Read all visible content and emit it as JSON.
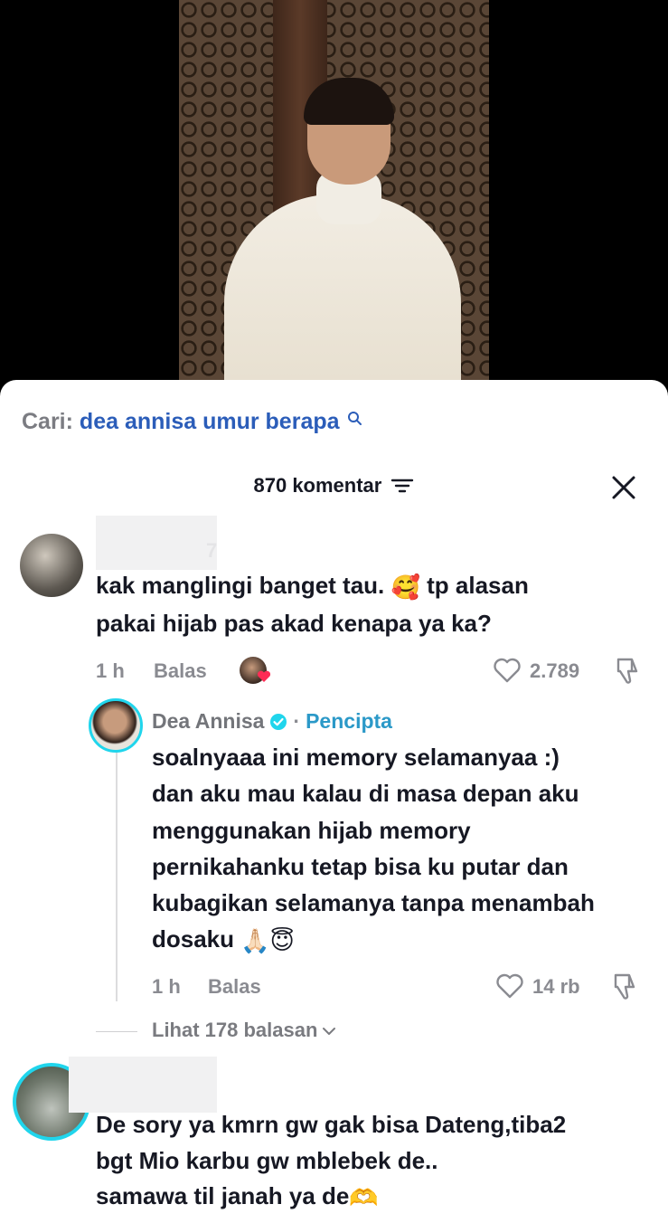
{
  "search": {
    "prefix": "Cari:",
    "query": "dea annisa umur berapa"
  },
  "header": {
    "count_label": "870 komentar"
  },
  "comments": [
    {
      "username_partial": "7",
      "text_line1": "kak manglingi banget tau.",
      "text_line1_emoji": "🥰",
      "text_line1_tail": "tp alasan",
      "text_line2": "pakai hijab pas akad kenapa ya ka?",
      "time": "1 h",
      "reply_label": "Balas",
      "likes": "2.789"
    },
    {
      "username_partial": "",
      "text_line1": "De sory ya kmrn gw gak bisa Dateng,tiba2",
      "text_line2": "bgt Mio karbu gw mblebek de..",
      "text_line3": "samawa til janah ya de",
      "text_line3_emoji": "🫶"
    }
  ],
  "reply": {
    "author": "Dea Annisa",
    "separator": "·",
    "badge": "Pencipta",
    "lines": [
      "soalnyaaa ini memory selamanyaa :)",
      "dan aku mau kalau di masa depan aku",
      "menggunakan hijab memory",
      "pernikahanku tetap bisa ku putar dan",
      "kubagikan selamanya tanpa menambah",
      "dosaku"
    ],
    "emoji_tail": "🙏🏻😇",
    "time": "1 h",
    "reply_label": "Balas",
    "likes": "14 rb"
  },
  "view_replies": {
    "label": "Lihat 178 balasan"
  },
  "colors": {
    "link_blue": "#2b5db9",
    "creator_blue": "#2b99c8",
    "verified": "#20d5ec",
    "muted": "#8a8b91"
  }
}
